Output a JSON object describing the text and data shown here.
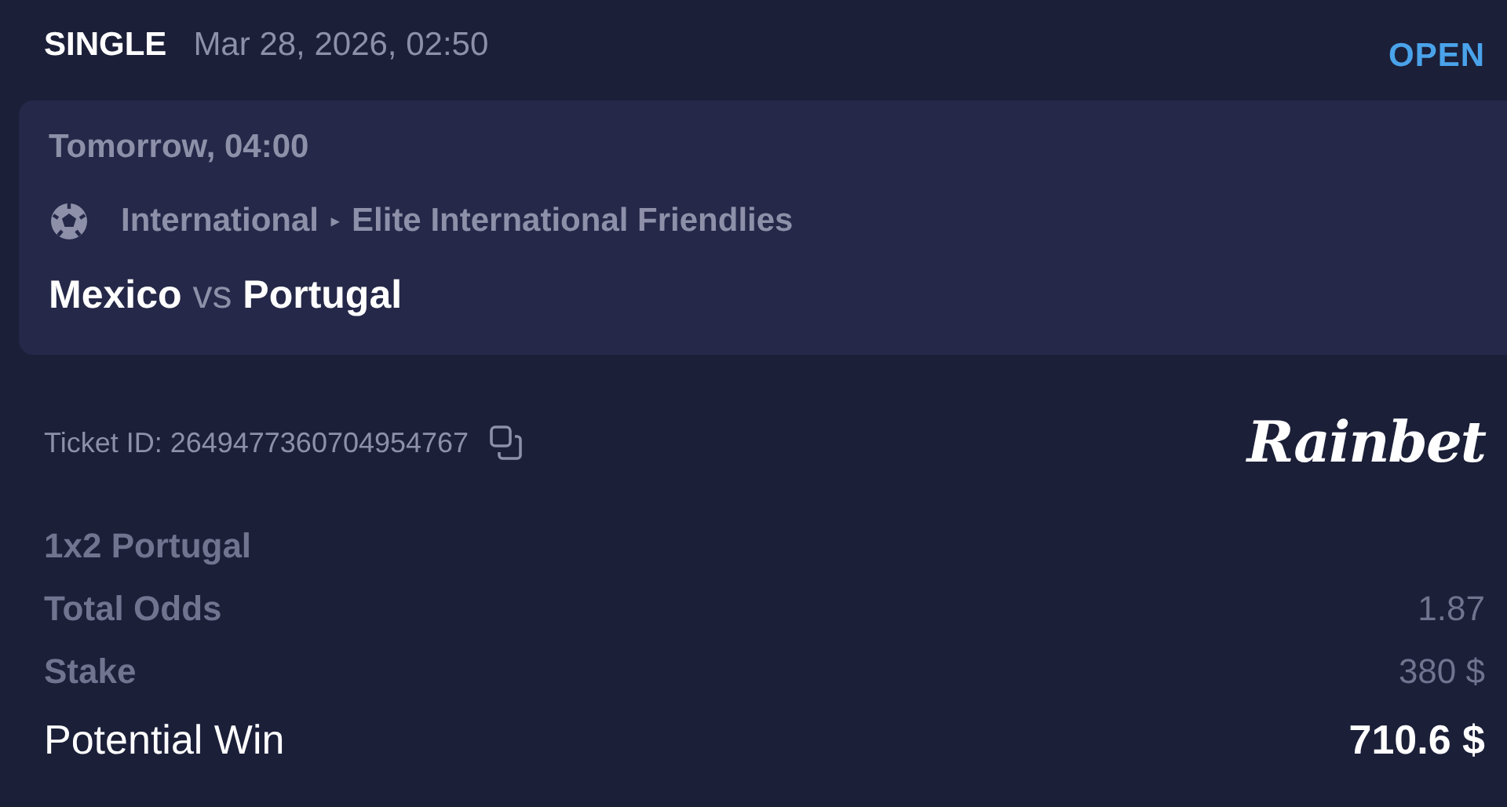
{
  "header": {
    "bet_type": "SINGLE",
    "placed_at": "Mar 28, 2026, 02:50",
    "status": "OPEN"
  },
  "event": {
    "start": "Tomorrow, 04:00",
    "category": "International",
    "separator": "▸",
    "league": "Elite International Friendlies",
    "home": "Mexico",
    "vs": "vs",
    "away": "Portugal"
  },
  "ticket": {
    "id_text": "Ticket ID: 2649477360704954767",
    "brand": "Rainbet"
  },
  "summary": [
    {
      "kind": "selection",
      "label": "1x2 Portugal"
    },
    {
      "kind": "detail",
      "label": "Total Odds",
      "value": "1.87"
    },
    {
      "kind": "detail",
      "label": "Stake",
      "value": "380 $"
    },
    {
      "kind": "total",
      "label": "Potential Win",
      "value": "710.6 $"
    }
  ]
}
